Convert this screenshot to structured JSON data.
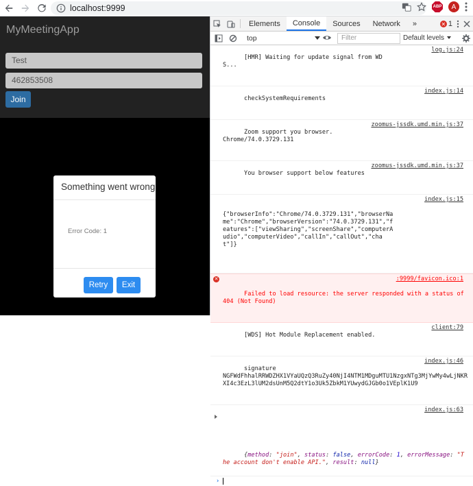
{
  "browser": {
    "url": "localhost:9999",
    "profile_initial": "A",
    "adblock_label": "ABP"
  },
  "app": {
    "title": "MyMeetingApp",
    "name_value": "Test",
    "meeting_value": "462853508",
    "join_label": "Join",
    "modal": {
      "title": "Something went wrong",
      "error_text": "Error Code: 1",
      "retry_label": "Retry",
      "exit_label": "Exit"
    }
  },
  "devtools": {
    "tabs": [
      "Elements",
      "Console",
      "Sources",
      "Network"
    ],
    "more_tabs": "»",
    "error_count": "1",
    "context": "top",
    "filter_placeholder": "Filter",
    "levels_label": "Default levels",
    "messages": [
      {
        "text": "[HMR] Waiting for update signal from WDS...",
        "src": "log.js:24"
      },
      {
        "text": "checkSystemRequirements",
        "src": "index.js:14"
      },
      {
        "text": "Zoom support you browser.\nChrome/74.0.3729.131",
        "src": "zoomus-jssdk.umd.min.js:37"
      },
      {
        "text": "You browser support below features",
        "src": "zoomus-jssdk.umd.min.js:37"
      },
      {
        "text": "{\"browserInfo\":\"Chrome/74.0.3729.131\",\"browserName\":\"Chrome\",\"browserVersion\":\"74.0.3729.131\",\"features\":[\"viewSharing\",\"screenShare\",\"computerAudio\",\"computerVideo\",\"callIn\",\"callOut\",\"chat\"]}",
        "src": "index.js:15"
      },
      {
        "text": "Failed to load resource: the server responded with a status of 404 (Not Found)",
        "src": ":9999/favicon.ico:1"
      },
      {
        "text": "[WDS] Hot Module Replacement enabled.",
        "src": "client:79"
      },
      {
        "text": "signature\nNGFWdFhhalRRWDZHX1VYaUQzQ3RuZy40NjI4NTM1MDguMTU1NzgxNTg3MjYwMy4wLjNKRXI4c3EzL3lUM2dsUnM5Q2dtY1o3Uk5ZbkM1YUwydGJGb0o1VEplK1U9",
        "src": "index.js:46"
      },
      {
        "text": "",
        "src": "index.js:63"
      }
    ],
    "object_log": {
      "k1": "method",
      "v1": "\"join\"",
      "k2": "status",
      "v2": "false",
      "k3": "errorCode",
      "v3": "1",
      "k4": "errorMessage",
      "v4": "\"The account don't enable API.\"",
      "k5": "result",
      "v5": "null"
    },
    "prompt_symbol": "›"
  }
}
